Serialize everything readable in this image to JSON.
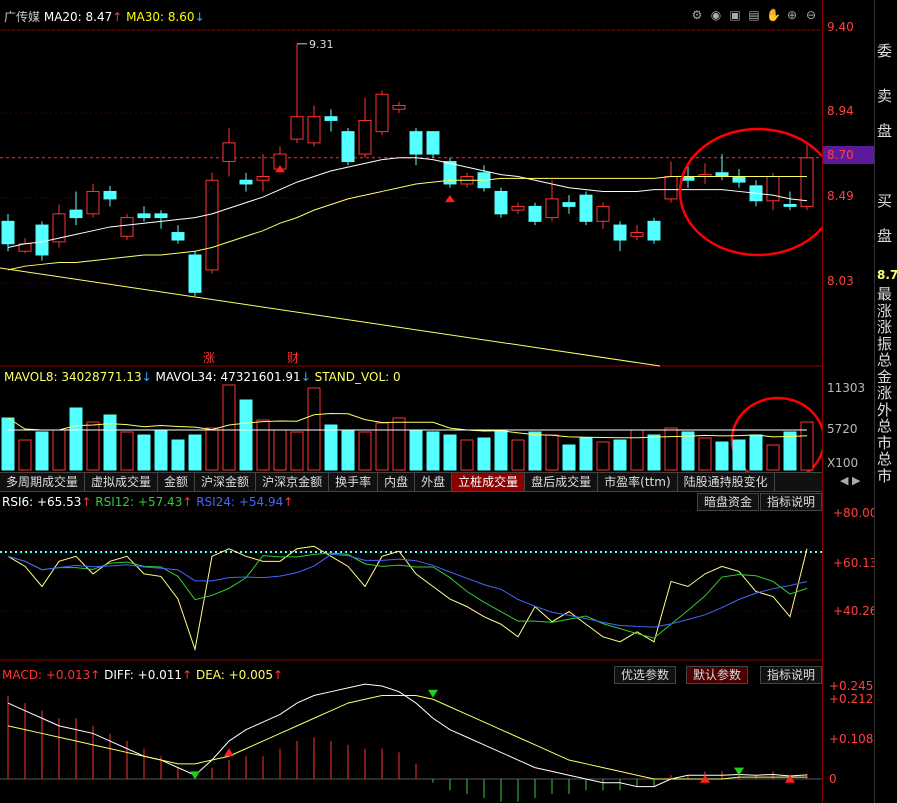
{
  "header": {
    "stock_name": "广传媒",
    "ma20_label": "MA20: 8.47",
    "ma30_label": "MA30: 8.60",
    "ma20_arrow": "↑",
    "ma30_arrow": "↓",
    "icons": [
      "settings-icon",
      "eye-icon",
      "lock-icon",
      "grid-icon",
      "hand-icon",
      "zoom-in-icon",
      "zoom-out-icon"
    ],
    "high_marker": "9.31",
    "event_1": "涨",
    "event_2": "财"
  },
  "price_axis": {
    "labels": [
      "9.40",
      "8.94",
      "8.70",
      "8.49",
      "8.03"
    ],
    "current": "8.70"
  },
  "side_panel": {
    "chars": [
      "委",
      "卖",
      "盘",
      "买",
      "盘"
    ],
    "price": "8.7",
    "small": [
      "最",
      "涨",
      "涨",
      "振",
      "总",
      "金",
      "涨",
      "外",
      "总",
      "市",
      "总",
      "市"
    ]
  },
  "volume_panel": {
    "mavol8": "MAVOL8: 34028771.13",
    "mavol34": "MAVOL34: 47321601.91",
    "stand_vol": "STAND_VOL: 0",
    "arrow8": "↓",
    "arrow34": "↓",
    "axis": [
      "11303",
      "5720",
      "X100"
    ]
  },
  "tabs": [
    "多周期成交量",
    "虚拟成交量",
    "金额",
    "沪深金额",
    "沪深京金额",
    "换手率",
    "内盘",
    "外盘",
    "立桩成交量",
    "盘后成交量",
    "市盈率(ttm)",
    "陆股通持股变化"
  ],
  "active_tab": "立桩成交量",
  "rsi_panel": {
    "rsi6": "RSI6: +65.53",
    "rsi12": "RSI12: +57.43",
    "rsi24": "RSI24: +54.94",
    "arrow6": "↑",
    "arrow12": "↑",
    "arrow24": "↑",
    "btn1": "暗盘资金",
    "btn2": "指标说明",
    "axis": [
      "+80.00",
      "+60.13",
      "+40.26"
    ]
  },
  "macd_panel": {
    "macd": "MACD: +0.013",
    "diff": "DIFF: +0.011",
    "dea": "DEA: +0.005",
    "arrow1": "↑",
    "arrow2": "↑",
    "arrow3": "↑",
    "btn1": "优选参数",
    "btn2": "默认参数",
    "btn3": "指标说明",
    "axis": [
      "+0.245",
      "+0.212",
      "+0.108",
      "0"
    ]
  },
  "colors": {
    "up": "#ff3333",
    "down": "#54ffff",
    "ma20": "#ffffff",
    "ma30": "#ffff66",
    "grid": "#8b0000",
    "annot": "#ff0000"
  },
  "chart_data": {
    "type": "candlestick",
    "candles": [
      {
        "o": 8.36,
        "c": 8.24,
        "h": 8.4,
        "l": 8.2
      },
      {
        "o": 8.2,
        "c": 8.24,
        "h": 8.27,
        "l": 8.19
      },
      {
        "o": 8.34,
        "c": 8.18,
        "h": 8.36,
        "l": 8.15
      },
      {
        "o": 8.25,
        "c": 8.4,
        "h": 8.45,
        "l": 8.22
      },
      {
        "o": 8.42,
        "c": 8.38,
        "h": 8.52,
        "l": 8.34
      },
      {
        "o": 8.4,
        "c": 8.52,
        "h": 8.56,
        "l": 8.38
      },
      {
        "o": 8.52,
        "c": 8.48,
        "h": 8.55,
        "l": 8.44
      },
      {
        "o": 8.28,
        "c": 8.38,
        "h": 8.4,
        "l": 8.26
      },
      {
        "o": 8.4,
        "c": 8.38,
        "h": 8.44,
        "l": 8.36
      },
      {
        "o": 8.4,
        "c": 8.38,
        "h": 8.42,
        "l": 8.32
      },
      {
        "o": 8.3,
        "c": 8.26,
        "h": 8.34,
        "l": 8.24
      },
      {
        "o": 8.18,
        "c": 7.98,
        "h": 8.2,
        "l": 7.96
      },
      {
        "o": 8.1,
        "c": 8.58,
        "h": 8.62,
        "l": 8.08
      },
      {
        "o": 8.68,
        "c": 8.78,
        "h": 8.86,
        "l": 8.6
      },
      {
        "o": 8.58,
        "c": 8.56,
        "h": 8.62,
        "l": 8.52
      },
      {
        "o": 8.58,
        "c": 8.6,
        "h": 8.72,
        "l": 8.52
      },
      {
        "o": 8.64,
        "c": 8.72,
        "h": 8.76,
        "l": 8.62
      },
      {
        "o": 8.8,
        "c": 8.92,
        "h": 9.31,
        "l": 8.78
      },
      {
        "o": 8.78,
        "c": 8.92,
        "h": 8.98,
        "l": 8.76
      },
      {
        "o": 8.92,
        "c": 8.9,
        "h": 8.96,
        "l": 8.84
      },
      {
        "o": 8.84,
        "c": 8.68,
        "h": 8.86,
        "l": 8.66
      },
      {
        "o": 8.72,
        "c": 8.9,
        "h": 9.02,
        "l": 8.7
      },
      {
        "o": 8.84,
        "c": 9.04,
        "h": 9.06,
        "l": 8.82
      },
      {
        "o": 8.96,
        "c": 8.98,
        "h": 9.0,
        "l": 8.94
      },
      {
        "o": 8.84,
        "c": 8.72,
        "h": 8.86,
        "l": 8.66
      },
      {
        "o": 8.84,
        "c": 8.72,
        "h": 8.84,
        "l": 8.7
      },
      {
        "o": 8.68,
        "c": 8.56,
        "h": 8.7,
        "l": 8.54
      },
      {
        "o": 8.56,
        "c": 8.6,
        "h": 8.62,
        "l": 8.54
      },
      {
        "o": 8.62,
        "c": 8.54,
        "h": 8.66,
        "l": 8.52
      },
      {
        "o": 8.52,
        "c": 8.4,
        "h": 8.54,
        "l": 8.38
      },
      {
        "o": 8.42,
        "c": 8.44,
        "h": 8.46,
        "l": 8.4
      },
      {
        "o": 8.44,
        "c": 8.36,
        "h": 8.46,
        "l": 8.34
      },
      {
        "o": 8.38,
        "c": 8.48,
        "h": 8.58,
        "l": 8.36
      },
      {
        "o": 8.46,
        "c": 8.44,
        "h": 8.5,
        "l": 8.4
      },
      {
        "o": 8.5,
        "c": 8.36,
        "h": 8.52,
        "l": 8.34
      },
      {
        "o": 8.36,
        "c": 8.44,
        "h": 8.46,
        "l": 8.32
      },
      {
        "o": 8.34,
        "c": 8.26,
        "h": 8.36,
        "l": 8.2
      },
      {
        "o": 8.28,
        "c": 8.3,
        "h": 8.34,
        "l": 8.26
      },
      {
        "o": 8.36,
        "c": 8.26,
        "h": 8.38,
        "l": 8.24
      },
      {
        "o": 8.48,
        "c": 8.6,
        "h": 8.68,
        "l": 8.46
      },
      {
        "o": 8.6,
        "c": 8.58,
        "h": 8.66,
        "l": 8.54
      },
      {
        "o": 8.6,
        "c": 8.61,
        "h": 8.67,
        "l": 8.56
      },
      {
        "o": 8.62,
        "c": 8.6,
        "h": 8.72,
        "l": 8.58
      },
      {
        "o": 8.6,
        "c": 8.57,
        "h": 8.64,
        "l": 8.54
      },
      {
        "o": 8.55,
        "c": 8.47,
        "h": 8.58,
        "l": 8.44
      },
      {
        "o": 8.47,
        "c": 8.6,
        "h": 8.62,
        "l": 8.42
      },
      {
        "o": 8.45,
        "c": 8.44,
        "h": 8.52,
        "l": 8.42
      },
      {
        "o": 8.44,
        "c": 8.7,
        "h": 8.78,
        "l": 8.42
      }
    ],
    "ma20": [
      8.22,
      8.24,
      8.25,
      8.27,
      8.29,
      8.31,
      8.33,
      8.34,
      8.35,
      8.36,
      8.37,
      8.38,
      8.4,
      8.43,
      8.46,
      8.49,
      8.53,
      8.57,
      8.6,
      8.63,
      8.65,
      8.67,
      8.69,
      8.7,
      8.7,
      8.69,
      8.67,
      8.65,
      8.63,
      8.61,
      8.6,
      8.58,
      8.56,
      8.54,
      8.53,
      8.52,
      8.52,
      8.52,
      8.53,
      8.53,
      8.53,
      8.53,
      8.53,
      8.52,
      8.51,
      8.5,
      8.48,
      8.47
    ],
    "ma30": [
      8.1,
      8.12,
      8.13,
      8.14,
      8.14,
      8.15,
      8.16,
      8.17,
      8.18,
      8.18,
      8.19,
      8.2,
      8.22,
      8.25,
      8.28,
      8.31,
      8.35,
      8.38,
      8.42,
      8.45,
      8.48,
      8.5,
      8.52,
      8.54,
      8.56,
      8.57,
      8.58,
      8.58,
      8.58,
      8.59,
      8.59,
      8.59,
      8.59,
      8.59,
      8.59,
      8.59,
      8.59,
      8.59,
      8.59,
      8.6,
      8.6,
      8.6,
      8.6,
      8.6,
      8.6,
      8.6,
      8.6,
      8.6
    ],
    "current_price": 8.7,
    "volumes": [
      52,
      30,
      38,
      40,
      62,
      48,
      55,
      38,
      35,
      40,
      30,
      35,
      42,
      85,
      70,
      50,
      40,
      38,
      82,
      45,
      40,
      38,
      47,
      52,
      40,
      38,
      35,
      30,
      32,
      40,
      30,
      38,
      35,
      25,
      32,
      28,
      30,
      40,
      35,
      42,
      38,
      32,
      28,
      30,
      35,
      25,
      38,
      48
    ],
    "rsi6": [
      62,
      58,
      50,
      60,
      62,
      55,
      60,
      62,
      55,
      54,
      45,
      25,
      62,
      65,
      62,
      60,
      60,
      65,
      66,
      62,
      58,
      50,
      62,
      64,
      55,
      50,
      45,
      42,
      38,
      35,
      30,
      42,
      36,
      40,
      35,
      30,
      28,
      32,
      28,
      52,
      50,
      55,
      58,
      56,
      48,
      46,
      38,
      65
    ],
    "macd_hist": [
      0.22,
      0.2,
      0.18,
      0.16,
      0.16,
      0.14,
      0.12,
      0.1,
      0.08,
      0.06,
      0.03,
      0.01,
      0.03,
      0.05,
      0.06,
      0.06,
      0.08,
      0.1,
      0.11,
      0.1,
      0.09,
      0.08,
      0.08,
      0.07,
      0.04,
      -0.01,
      -0.03,
      -0.04,
      -0.05,
      -0.06,
      -0.06,
      -0.05,
      -0.04,
      -0.04,
      -0.03,
      -0.03,
      -0.03,
      -0.02,
      -0.02,
      0.01,
      0.01,
      0.02,
      0.02,
      0.02,
      0.01,
      0.02,
      0.01,
      0.013
    ],
    "diff": [
      0.2,
      0.18,
      0.16,
      0.14,
      0.13,
      0.12,
      0.1,
      0.08,
      0.06,
      0.05,
      0.03,
      0.01,
      0.05,
      0.1,
      0.13,
      0.15,
      0.17,
      0.2,
      0.22,
      0.23,
      0.24,
      0.25,
      0.245,
      0.23,
      0.2,
      0.16,
      0.13,
      0.11,
      0.09,
      0.07,
      0.05,
      0.03,
      0.02,
      0.01,
      0.0,
      -0.01,
      -0.01,
      -0.02,
      -0.02,
      0.0,
      0.01,
      0.01,
      0.01,
      0.012,
      0.01,
      0.012,
      0.008,
      0.011
    ],
    "dea": [
      0.14,
      0.13,
      0.12,
      0.11,
      0.1,
      0.09,
      0.08,
      0.07,
      0.06,
      0.05,
      0.04,
      0.04,
      0.05,
      0.06,
      0.08,
      0.1,
      0.12,
      0.14,
      0.16,
      0.18,
      0.2,
      0.21,
      0.22,
      0.22,
      0.22,
      0.21,
      0.19,
      0.17,
      0.15,
      0.13,
      0.11,
      0.09,
      0.07,
      0.05,
      0.04,
      0.03,
      0.02,
      0.01,
      0.0,
      0.0,
      0.0,
      0.0,
      0.0,
      0.005,
      0.005,
      0.005,
      0.005,
      0.005
    ]
  }
}
